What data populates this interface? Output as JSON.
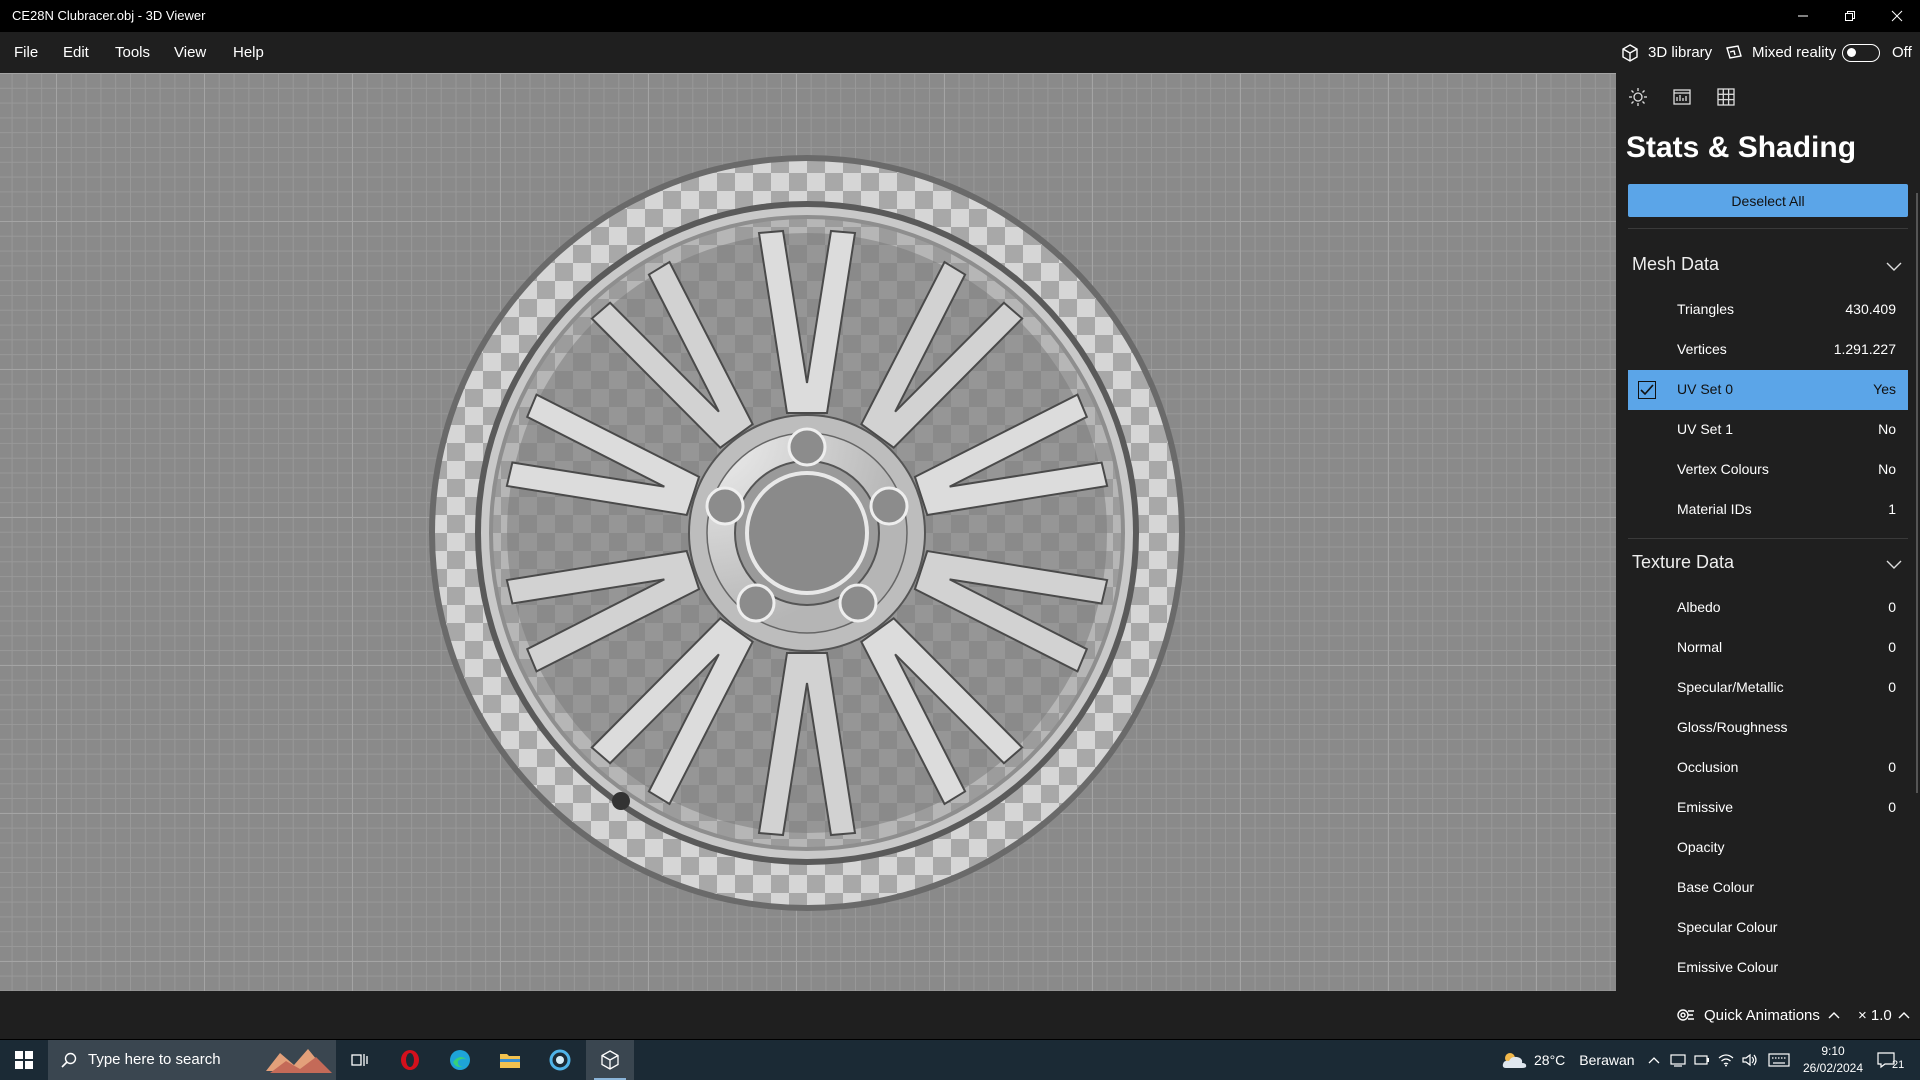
{
  "window": {
    "title": "CE28N Clubracer.obj - 3D Viewer"
  },
  "menu": {
    "items": [
      "File",
      "Edit",
      "Tools",
      "View",
      "Help"
    ],
    "library_label": "3D library",
    "mixed_reality_label": "Mixed reality",
    "mixed_reality_state": "Off"
  },
  "panel": {
    "tab_icons": [
      "lighting-icon",
      "stats-icon",
      "grid-icon"
    ],
    "active_tab": 1,
    "title": "Stats & Shading",
    "deselect_label": "Deselect All",
    "mesh": {
      "heading": "Mesh Data",
      "rows": [
        {
          "label": "Triangles",
          "value": "430.409"
        },
        {
          "label": "Vertices",
          "value": "1.291.227"
        },
        {
          "label": "UV Set 0",
          "value": "Yes",
          "selected": true
        },
        {
          "label": "UV Set 1",
          "value": "No"
        },
        {
          "label": "Vertex Colours",
          "value": "No"
        },
        {
          "label": "Material IDs",
          "value": "1"
        }
      ]
    },
    "texture": {
      "heading": "Texture Data",
      "rows": [
        {
          "label": "Albedo",
          "value": "0"
        },
        {
          "label": "Normal",
          "value": "0"
        },
        {
          "label": "Specular/Metallic",
          "value": "0"
        },
        {
          "label": "Gloss/Roughness",
          "value": ""
        },
        {
          "label": "Occlusion",
          "value": "0"
        },
        {
          "label": "Emissive",
          "value": "0"
        },
        {
          "label": "Opacity",
          "value": ""
        },
        {
          "label": "Base Colour",
          "value": ""
        },
        {
          "label": "Specular Colour",
          "value": ""
        },
        {
          "label": "Emissive Colour",
          "value": ""
        }
      ]
    }
  },
  "bottom": {
    "quick_animations_label": "Quick Animations",
    "speed": "× 1.0"
  },
  "taskbar": {
    "search_placeholder": "Type here to search",
    "weather_temp": "28°C",
    "weather_text": "Berawan",
    "time": "9:10",
    "date": "26/02/2024",
    "notification_count": "21"
  },
  "colors": {
    "accent": "#5ba5e8",
    "panel_bg": "#1f1f1f",
    "taskbar_bg": "#1b2a35",
    "viewport_bg": "#8a8a8a"
  }
}
